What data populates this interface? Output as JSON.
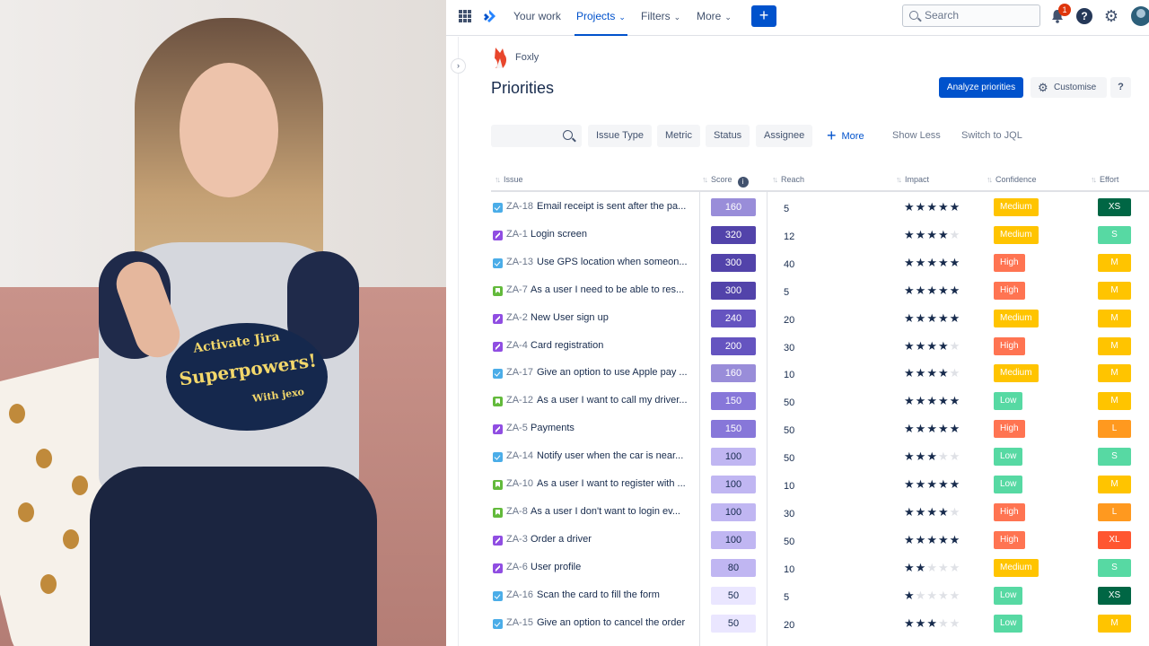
{
  "video_overlay": {
    "shirt_print_line1": "Activate Jira",
    "shirt_print_line2": "Superpowers!",
    "shirt_print_line3": "With jexo"
  },
  "topbar": {
    "nav": [
      {
        "label": "Your work",
        "active": false,
        "dropdown": false
      },
      {
        "label": "Projects",
        "active": true,
        "dropdown": true
      },
      {
        "label": "Filters",
        "active": false,
        "dropdown": true
      },
      {
        "label": "More",
        "active": false,
        "dropdown": true
      }
    ],
    "create_label": "+",
    "search_placeholder": "Search",
    "notifications_count": "1",
    "help_label": "?"
  },
  "project": {
    "name": "Foxly"
  },
  "page": {
    "title": "Priorities",
    "analyze_label": "Analyze priorities",
    "customise_label": "Customise",
    "help_label": "?"
  },
  "filters": {
    "buttons": [
      "Issue Type",
      "Metric",
      "Status",
      "Assignee"
    ],
    "more_label": "More",
    "show_less_label": "Show Less",
    "switch_jql_label": "Switch to JQL"
  },
  "table": {
    "headers": {
      "issue": "Issue",
      "score": "Score",
      "reach": "Reach",
      "impact": "Impact",
      "confidence": "Confidence",
      "effort": "Effort"
    },
    "rows": [
      {
        "key": "ZA-18",
        "summary": "Email receipt is sent after the pa...",
        "type": "task",
        "score": "160",
        "reach": "5",
        "impact": 5,
        "confidence": "Medium",
        "effort": "XS"
      },
      {
        "key": "ZA-1",
        "summary": "Login screen",
        "type": "epic",
        "score": "320",
        "reach": "12",
        "impact": 4,
        "confidence": "Medium",
        "effort": "S"
      },
      {
        "key": "ZA-13",
        "summary": "Use GPS location when someon...",
        "type": "task",
        "score": "300",
        "reach": "40",
        "impact": 5,
        "confidence": "High",
        "effort": "M"
      },
      {
        "key": "ZA-7",
        "summary": "As a user I need to be able to res...",
        "type": "story",
        "score": "300",
        "reach": "5",
        "impact": 5,
        "confidence": "High",
        "effort": "M"
      },
      {
        "key": "ZA-2",
        "summary": "New User sign up",
        "type": "epic",
        "score": "240",
        "reach": "20",
        "impact": 5,
        "confidence": "Medium",
        "effort": "M"
      },
      {
        "key": "ZA-4",
        "summary": "Card registration",
        "type": "epic",
        "score": "200",
        "reach": "30",
        "impact": 4,
        "confidence": "High",
        "effort": "M"
      },
      {
        "key": "ZA-17",
        "summary": "Give an option to use Apple pay ...",
        "type": "task",
        "score": "160",
        "reach": "10",
        "impact": 4,
        "confidence": "Medium",
        "effort": "M"
      },
      {
        "key": "ZA-12",
        "summary": "As a user I want to call my driver...",
        "type": "story",
        "score": "150",
        "reach": "50",
        "impact": 5,
        "confidence": "Low",
        "effort": "M"
      },
      {
        "key": "ZA-5",
        "summary": "Payments",
        "type": "epic",
        "score": "150",
        "reach": "50",
        "impact": 5,
        "confidence": "High",
        "effort": "L"
      },
      {
        "key": "ZA-14",
        "summary": "Notify user when the car is near...",
        "type": "task",
        "score": "100",
        "reach": "50",
        "impact": 3,
        "confidence": "Low",
        "effort": "S"
      },
      {
        "key": "ZA-10",
        "summary": "As a user I want to register with ...",
        "type": "story",
        "score": "100",
        "reach": "10",
        "impact": 5,
        "confidence": "Low",
        "effort": "M"
      },
      {
        "key": "ZA-8",
        "summary": "As a user I don't want to login ev...",
        "type": "story",
        "score": "100",
        "reach": "30",
        "impact": 4,
        "confidence": "High",
        "effort": "L"
      },
      {
        "key": "ZA-3",
        "summary": "Order a driver",
        "type": "epic",
        "score": "100",
        "reach": "50",
        "impact": 5,
        "confidence": "High",
        "effort": "XL"
      },
      {
        "key": "ZA-6",
        "summary": "User profile",
        "type": "epic",
        "score": "80",
        "reach": "10",
        "impact": 2,
        "confidence": "Medium",
        "effort": "S"
      },
      {
        "key": "ZA-16",
        "summary": "Scan the card to fill the form",
        "type": "task",
        "score": "50",
        "reach": "5",
        "impact": 1,
        "confidence": "Low",
        "effort": "XS"
      },
      {
        "key": "ZA-15",
        "summary": "Give an option to cancel the order",
        "type": "task",
        "score": "50",
        "reach": "20",
        "impact": 3,
        "confidence": "Low",
        "effort": "M"
      }
    ]
  },
  "colors": {
    "primary": "#0052cc",
    "score_scale": [
      "#5243aa",
      "#6554c0",
      "#8777d9",
      "#998dd9",
      "#c0b6f2"
    ],
    "confidence": {
      "High": "#ff7452",
      "Medium": "#ffc400",
      "Low": "#57d9a3"
    },
    "effort": {
      "XS": "#006644",
      "S": "#57d9a3",
      "M": "#ffc400",
      "L": "#ff991f",
      "XL": "#ff5630"
    }
  }
}
